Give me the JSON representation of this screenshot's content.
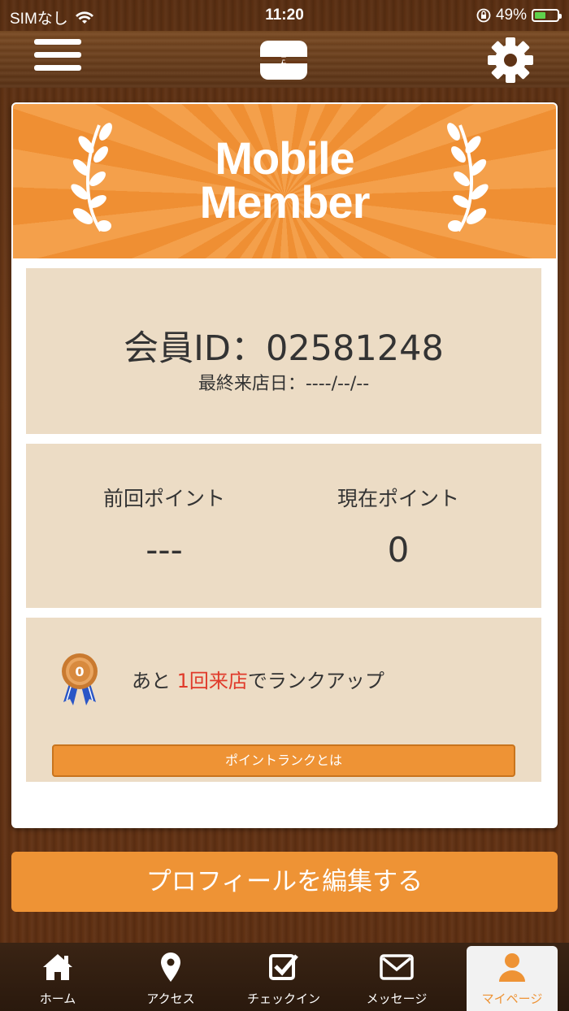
{
  "status": {
    "carrier": "SIMなし",
    "time": "11:20",
    "battery": "49%"
  },
  "header": {
    "menu_icon": "hamburger-icon",
    "logo_icon": "logo-icon",
    "settings_icon": "gear-icon"
  },
  "banner": {
    "title_line1": "Mobile",
    "title_line2": "Member"
  },
  "member": {
    "id_label": "会員ID：02581248",
    "last_visit": "最終来店日：----/--/--"
  },
  "points": {
    "previous_label": "前回ポイント",
    "previous_value": "---",
    "current_label": "現在ポイント",
    "current_value": "0"
  },
  "rank": {
    "prefix": "あと ",
    "highlight": "1回来店",
    "suffix": "でランクアップ",
    "button_label": "ポイントランクとは"
  },
  "edit_profile_label": "プロフィールを編集する",
  "tabs": [
    {
      "label": "ホーム",
      "icon": "home-icon"
    },
    {
      "label": "アクセス",
      "icon": "map-pin-icon"
    },
    {
      "label": "チェックイン",
      "icon": "checkin-icon"
    },
    {
      "label": "メッセージ",
      "icon": "mail-icon"
    },
    {
      "label": "マイページ",
      "icon": "user-icon"
    }
  ],
  "colors": {
    "accent": "#ee9335",
    "panel": "#ecdcc5",
    "highlight": "#e03a2a",
    "active_tab_text": "#ee9335"
  }
}
